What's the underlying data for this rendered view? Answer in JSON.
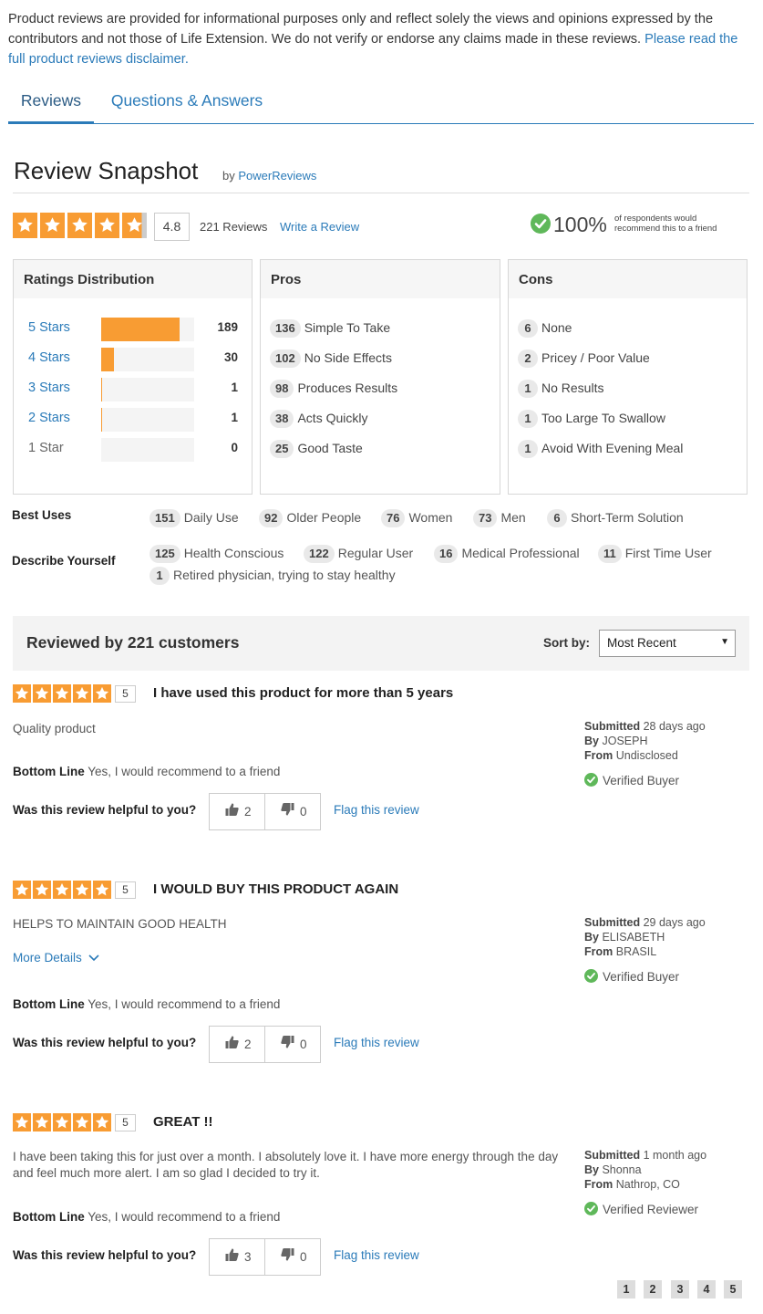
{
  "disclaimer": {
    "text": "Product reviews are provided for informational purposes only and reflect solely the views and opinions expressed by the contributors and not those of Life Extension. We do not verify or endorse any claims made in these reviews.",
    "link": "Please read the full product reviews disclaimer."
  },
  "tabs": [
    {
      "label": "Reviews",
      "active": true
    },
    {
      "label": "Questions & Answers",
      "active": false
    }
  ],
  "snapshot": {
    "title": "Review Snapshot",
    "by_prefix": "by",
    "by_name": "PowerReviews",
    "rating": "4.8",
    "rating_value": 4.8,
    "review_count": "221 Reviews",
    "write_review": "Write a Review",
    "recommend_pct": "100%",
    "recommend_text": "of respondents would recommend this to a friend"
  },
  "distribution": {
    "title": "Ratings Distribution",
    "max": 189,
    "rows": [
      {
        "label": "5 Stars",
        "count": "189",
        "value": 189
      },
      {
        "label": "4 Stars",
        "count": "30",
        "value": 30
      },
      {
        "label": "3 Stars",
        "count": "1",
        "value": 1
      },
      {
        "label": "2 Stars",
        "count": "1",
        "value": 1
      },
      {
        "label": "1 Star",
        "count": "0",
        "value": 0
      }
    ]
  },
  "pros": {
    "title": "Pros",
    "items": [
      {
        "count": "136",
        "label": "Simple To Take"
      },
      {
        "count": "102",
        "label": "No Side Effects"
      },
      {
        "count": "98",
        "label": "Produces Results"
      },
      {
        "count": "38",
        "label": "Acts Quickly"
      },
      {
        "count": "25",
        "label": "Good Taste"
      }
    ]
  },
  "cons": {
    "title": "Cons",
    "items": [
      {
        "count": "6",
        "label": "None"
      },
      {
        "count": "2",
        "label": "Pricey / Poor Value"
      },
      {
        "count": "1",
        "label": "No Results"
      },
      {
        "count": "1",
        "label": "Too Large To Swallow"
      },
      {
        "count": "1",
        "label": "Avoid With Evening Meal"
      }
    ]
  },
  "best_uses": {
    "label": "Best Uses",
    "items": [
      {
        "count": "151",
        "label": "Daily Use"
      },
      {
        "count": "92",
        "label": "Older People"
      },
      {
        "count": "76",
        "label": "Women"
      },
      {
        "count": "73",
        "label": "Men"
      },
      {
        "count": "6",
        "label": "Short-Term Solution"
      }
    ]
  },
  "describe": {
    "label": "Describe Yourself",
    "items": [
      {
        "count": "125",
        "label": "Health Conscious"
      },
      {
        "count": "122",
        "label": "Regular User"
      },
      {
        "count": "16",
        "label": "Medical Professional"
      },
      {
        "count": "11",
        "label": "First Time User"
      },
      {
        "count": "1",
        "label": "Retired physician, trying to stay healthy"
      }
    ]
  },
  "reviews_bar": {
    "title": "Reviewed by 221 customers",
    "sort_label": "Sort by:",
    "sort_value": "Most Recent"
  },
  "common": {
    "bottom_line_label": "Bottom Line",
    "helpful_q": "Was this review helpful to you?",
    "flag": "Flag this review",
    "submitted": "Submitted",
    "by": "By",
    "from": "From",
    "more_details": "More Details"
  },
  "reviews": [
    {
      "score": "5",
      "title": "I have used this product for more than 5 years",
      "body": "Quality product",
      "bottom_line": "Yes, I would recommend to a friend",
      "up": "2",
      "down": "0",
      "submitted": "28 days ago",
      "author": "JOSEPH",
      "location": "Undisclosed",
      "badge": "Verified Buyer"
    },
    {
      "score": "5",
      "title": "I WOULD BUY THIS PRODUCT AGAIN",
      "body": "HELPS TO MAINTAIN GOOD HEALTH",
      "bottom_line": "Yes, I would recommend to a friend",
      "up": "2",
      "down": "0",
      "submitted": "29 days ago",
      "author": "ELISABETH",
      "location": "BRASIL",
      "badge": "Verified Buyer"
    },
    {
      "score": "5",
      "title": "GREAT !!",
      "body": "I have been taking this for just over a month. I absolutely love it. I have more energy through the day and feel much more alert. I am so glad I decided to try it.",
      "bottom_line": "Yes, I would recommend to a friend",
      "up": "3",
      "down": "0",
      "submitted": "1 month ago",
      "author": "Shonna",
      "location": "Nathrop, CO",
      "badge": "Verified Reviewer"
    }
  ],
  "pagination": [
    "1",
    "2",
    "3",
    "4",
    "5"
  ],
  "colors": {
    "accent": "#2b7bb9",
    "star": "#f89c33",
    "check": "#5fb85a"
  }
}
